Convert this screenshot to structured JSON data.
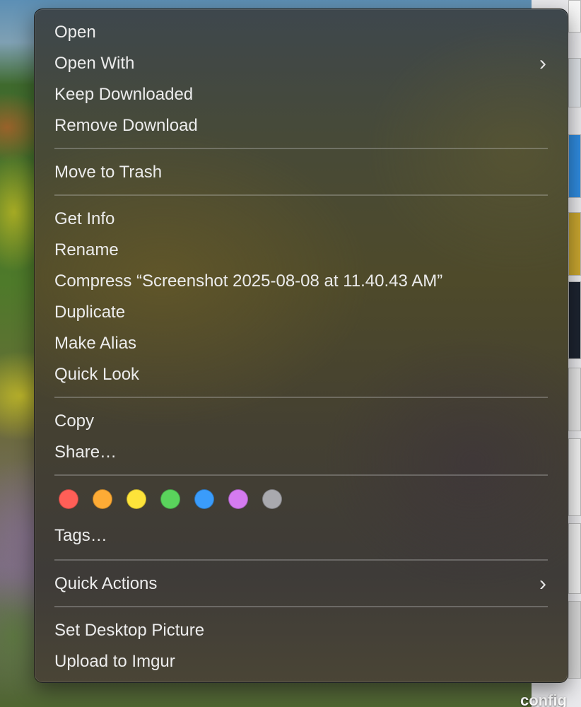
{
  "desktop": {
    "partial_label": "config"
  },
  "menu": {
    "items": [
      {
        "label": "Open",
        "submenu": false
      },
      {
        "label": "Open With",
        "submenu": true
      },
      {
        "label": "Keep Downloaded",
        "submenu": false
      },
      {
        "label": "Remove Download",
        "submenu": false
      },
      {
        "label": "Move to Trash",
        "submenu": false
      },
      {
        "label": "Get Info",
        "submenu": false
      },
      {
        "label": "Rename",
        "submenu": false
      },
      {
        "label": "Compress “Screenshot 2025-08-08 at 11.40.43 AM”",
        "submenu": false
      },
      {
        "label": "Duplicate",
        "submenu": false
      },
      {
        "label": "Make Alias",
        "submenu": false
      },
      {
        "label": "Quick Look",
        "submenu": false
      },
      {
        "label": "Copy",
        "submenu": false
      },
      {
        "label": "Share…",
        "submenu": false
      },
      {
        "label": "Tags…",
        "submenu": false
      },
      {
        "label": "Quick Actions",
        "submenu": true
      },
      {
        "label": "Set Desktop Picture",
        "submenu": false
      },
      {
        "label": "Upload to Imgur",
        "submenu": false
      }
    ],
    "submenu_glyph": "›",
    "tag_colors": [
      {
        "name": "red",
        "color": "#ff5f57"
      },
      {
        "name": "orange",
        "color": "#fdab35"
      },
      {
        "name": "yellow",
        "color": "#fde33a"
      },
      {
        "name": "green",
        "color": "#5ad35c"
      },
      {
        "name": "blue",
        "color": "#3a9cfb"
      },
      {
        "name": "purple",
        "color": "#d57bf0"
      },
      {
        "name": "gray",
        "color": "#a9a9ae"
      }
    ]
  }
}
